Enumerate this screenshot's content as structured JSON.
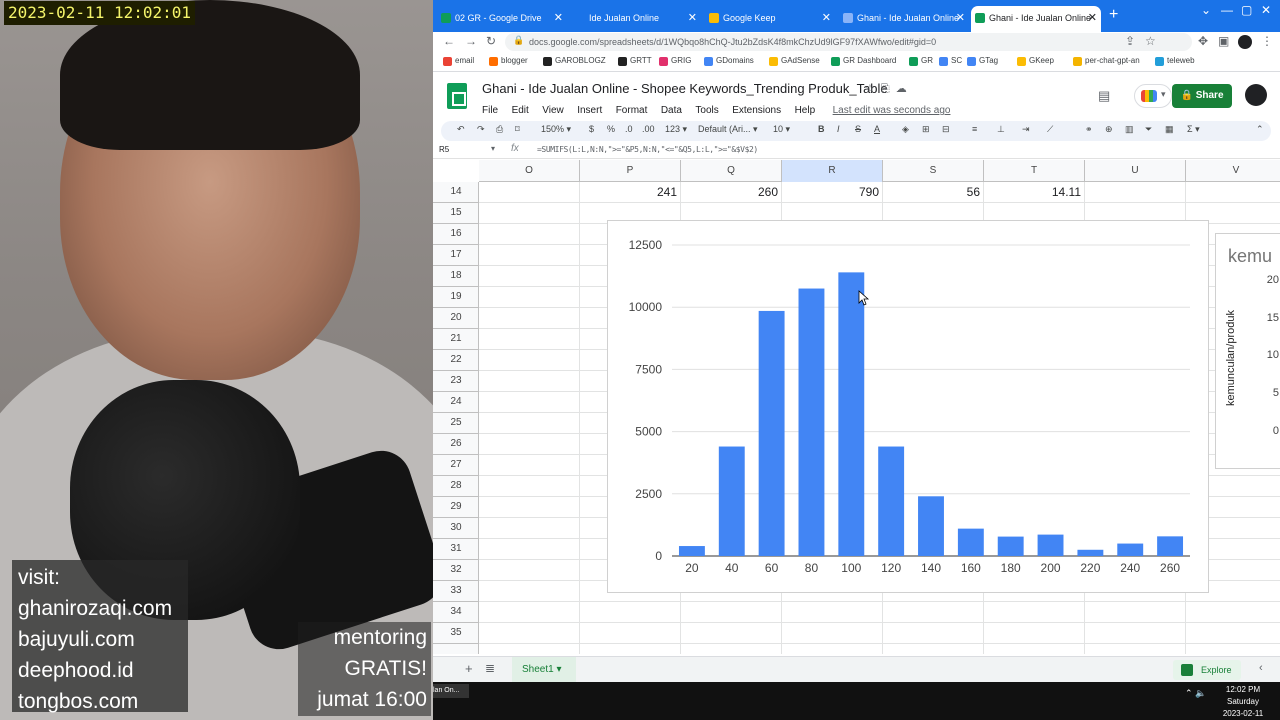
{
  "overlay": {
    "timestamp": "2023-02-11 12:02:01",
    "visit_lines": [
      "visit:",
      "ghanirozaqi.com",
      "bajuyuli.com",
      "deephood.id",
      "tongbos.com"
    ],
    "mentoring_lines": [
      "mentoring",
      "GRATIS!",
      "jumat 16:00"
    ]
  },
  "browser": {
    "tabs": [
      {
        "label": "02 GR - Google Drive",
        "color": "#0f9d58"
      },
      {
        "label": "Ide Jualan Online",
        "color": "#1a73e8"
      },
      {
        "label": "Google Keep",
        "color": "#fbbc04"
      },
      {
        "label": "Ghani - Ide Jualan Online",
        "color": "#8ab4f8"
      },
      {
        "label": "Ghani - Ide Jualan Online",
        "color": "#0f9d58"
      }
    ],
    "url": "docs.google.com/spreadsheets/d/1WQbqo8hChQ-Jtu2bZdsK4f8mkChzUd9lGF97fXAWfwo/edit#gid=0",
    "bookmarks": [
      {
        "label": "email",
        "color": "#ea4335"
      },
      {
        "label": "blogger",
        "color": "#ff6d00"
      },
      {
        "label": "GAROBLOGZ",
        "color": "#222222"
      },
      {
        "label": "GRTT",
        "color": "#222222"
      },
      {
        "label": "GRIG",
        "color": "#e1306c"
      },
      {
        "label": "GDomains",
        "color": "#4285f4"
      },
      {
        "label": "GAdSense",
        "color": "#fbbc04"
      },
      {
        "label": "GR Dashboard",
        "color": "#0f9d58"
      },
      {
        "label": "GR",
        "color": "#0f9d58"
      },
      {
        "label": "SC",
        "color": "#4285f4"
      },
      {
        "label": "GTag",
        "color": "#4285f4"
      },
      {
        "label": "GKeep",
        "color": "#fbbc04"
      },
      {
        "label": "per-chat-gpt-an",
        "color": "#f4b400"
      },
      {
        "label": "teleweb",
        "color": "#229ed9"
      }
    ]
  },
  "sheets": {
    "title": "Ghani - Ide Jualan Online - Shopee Keywords_Trending Produk_Table",
    "menu": [
      "File",
      "Edit",
      "View",
      "Insert",
      "Format",
      "Data",
      "Tools",
      "Extensions",
      "Help"
    ],
    "last_edit": "Last edit was seconds ago",
    "share_label": "Share",
    "toolbar": {
      "zoom": "150%",
      "currency": "$",
      "percent": "%",
      "decrease_decimal": ".0",
      "increase_decimal": ".00",
      "number_format": "123",
      "font": "Default (Ari...",
      "font_size": "10"
    },
    "cell_ref": "R5",
    "formula": "=SUMIFS(L:L,N:N,\">=\"&P5,N:N,\"<=\"&Q5,L:L,\">=\"&$V$2)",
    "columns": [
      "O",
      "P",
      "Q",
      "R",
      "S",
      "T",
      "U",
      "V"
    ],
    "selected_column": "R",
    "row_numbers": [
      "14",
      "15",
      "16",
      "17",
      "18",
      "19",
      "20",
      "21",
      "22",
      "23",
      "24",
      "25",
      "26",
      "27",
      "28",
      "29",
      "30",
      "31",
      "32",
      "33",
      "34",
      "35"
    ],
    "row14_values": {
      "P": "241",
      "Q": "260",
      "R": "790",
      "S": "56",
      "T": "14.11"
    },
    "sheet_tab": "Sheet1",
    "explore_label": "Explore"
  },
  "chart_data": [
    {
      "type": "bar",
      "categories": [
        "20",
        "40",
        "60",
        "80",
        "100",
        "120",
        "140",
        "160",
        "180",
        "200",
        "220",
        "240",
        "260"
      ],
      "values": [
        400,
        4400,
        9850,
        10750,
        11400,
        4400,
        2400,
        1100,
        780,
        860,
        250,
        500,
        790
      ],
      "title": "",
      "xlabel": "",
      "ylabel": "",
      "ylim": [
        0,
        12500
      ],
      "yticks": [
        0,
        2500,
        5000,
        7500,
        10000,
        12500
      ],
      "grid": true,
      "bar_color": "#4285f4"
    },
    {
      "type": "bar",
      "title": "kemu",
      "ylabel": "kemunculan/produk",
      "yticks": [
        "20",
        "15",
        "10",
        "5",
        "0"
      ]
    }
  ],
  "taskbar": {
    "app_label": "lan On...",
    "time": "12:02 PM",
    "day": "Saturday",
    "date": "2023-02-11"
  }
}
